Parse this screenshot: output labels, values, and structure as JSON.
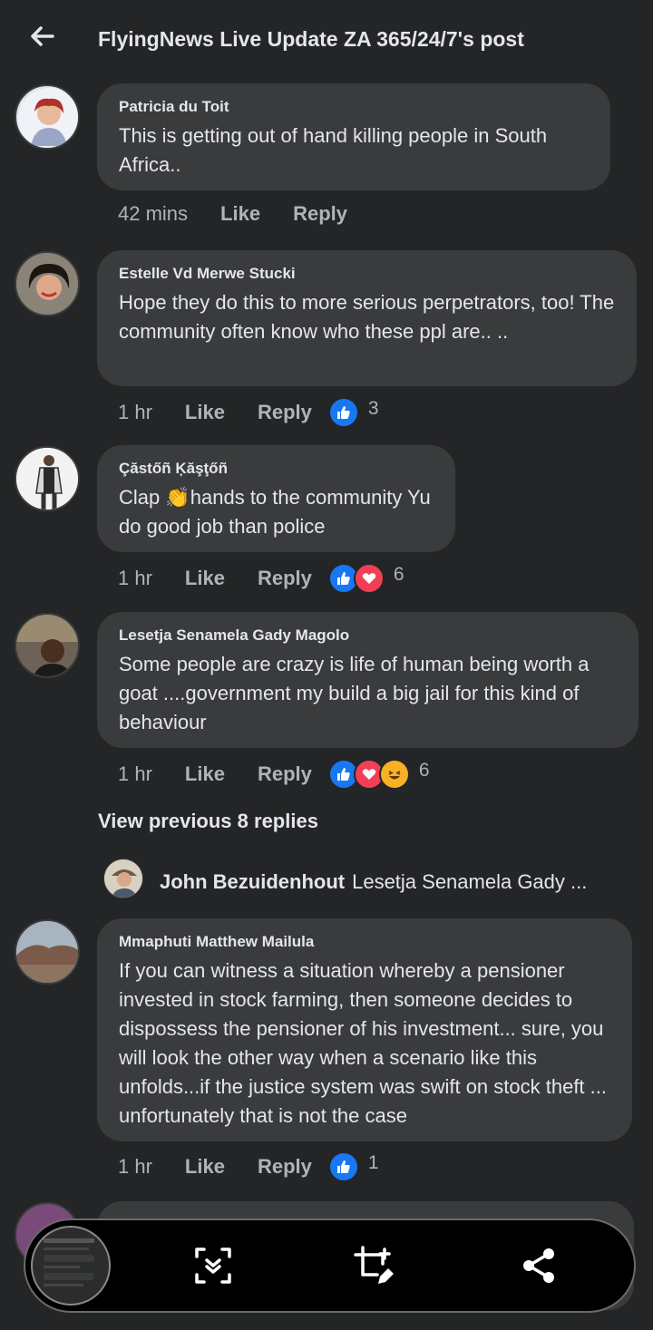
{
  "header": {
    "title": "FlyingNews Live Update ZA 365/24/7's post"
  },
  "labels": {
    "like": "Like",
    "reply": "Reply"
  },
  "comments": [
    {
      "name": "Patricia du Toit",
      "text": "This is getting out of hand killing people in South Africa..",
      "time": "42 mins",
      "reactions": [],
      "count": ""
    },
    {
      "name": "Estelle Vd Merwe Stucki",
      "text": "Hope they do this to more serious perpetrators, too! The community often know who these ppl are.. ..",
      "time": "1 hr",
      "reactions": [
        "like"
      ],
      "count": "3"
    },
    {
      "name": "Çăstőñ Ķăşţőñ",
      "text_before": "Clap ",
      "emoji": "👏",
      "text_after": "hands to the community Yu do good job than police",
      "time": "1 hr",
      "reactions": [
        "like",
        "love"
      ],
      "count": "6"
    },
    {
      "name": "Lesetja Senamela Gady Magolo",
      "text": "Some people are crazy is life of human being worth a goat ....government my build a big jail for this kind of behaviour",
      "time": "1 hr",
      "reactions": [
        "like",
        "love",
        "haha"
      ],
      "count": "6"
    },
    {
      "name": "Mmaphuti Matthew Mailula",
      "text": "If you can witness a situation whereby a pensioner invested in stock farming, then someone decides to dispossess the pensioner of his investment... sure, you will look the other way when a scenario like this unfolds...if the justice system was swift on stock theft ... unfortunately that is not the case",
      "time": "1 hr",
      "reactions": [
        "like"
      ],
      "count": "1"
    }
  ],
  "view_previous": "View previous 8 replies",
  "reply_preview": {
    "name": "John Bezuidenhout",
    "text": "Lesetja Senamela Gady ..."
  },
  "toolbar": {
    "icons": [
      "screenshot-thumbnail",
      "scroll-capture-icon",
      "edit-crop-icon",
      "share-icon"
    ]
  }
}
